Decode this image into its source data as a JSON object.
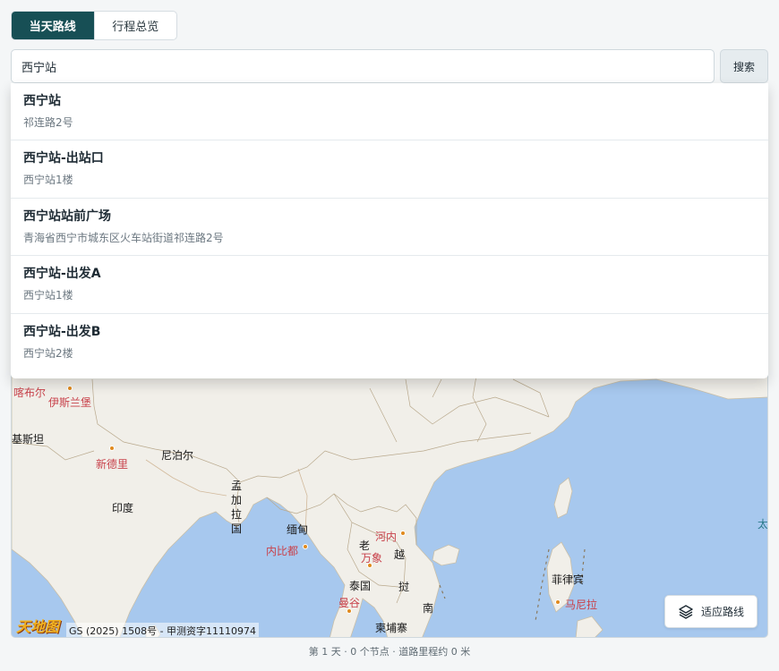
{
  "tabs": [
    {
      "label": "当天路线",
      "active": true
    },
    {
      "label": "行程总览",
      "active": false
    }
  ],
  "search": {
    "value": "西宁站",
    "button_label": "搜索"
  },
  "suggestions": [
    {
      "title": "西宁站",
      "subtitle": "祁连路2号"
    },
    {
      "title": "西宁站-出站口",
      "subtitle": "西宁站1楼"
    },
    {
      "title": "西宁站站前广场",
      "subtitle": "青海省西宁市城东区火车站街道祁连路2号"
    },
    {
      "title": "西宁站-出发A",
      "subtitle": "西宁站1楼"
    },
    {
      "title": "西宁站-出发B",
      "subtitle": "西宁站2楼"
    }
  ],
  "map": {
    "labels": {
      "kabul": "喀布尔",
      "islamabad": "伊斯兰堡",
      "pakistan": "巴基斯坦",
      "new_delhi": "新德里",
      "nepal": "尼泊尔",
      "india": "印度",
      "bangladesh": "孟加拉国",
      "myanmar": "缅甸",
      "naypyidaw": "内比都",
      "laos": "老",
      "hanoi": "河内",
      "vientiane": "万象",
      "vietnam_a": "越",
      "thailand": "泰国",
      "bangkok": "曼谷",
      "vietnam_b": "挝",
      "vietnam_c": "南",
      "cambodia": "柬埔寨",
      "philippines": "菲律宾",
      "manila": "马尼拉",
      "taiwan_edge": "太"
    },
    "provider_logo": "天地图",
    "copyright": "GS (2025) 1508号 - 甲测资字11110974",
    "fit_button_label": "适应路线",
    "layers_icon": "layers-icon"
  },
  "footer": {
    "status": "第 1 天 · 0 个节点 · 道路里程约 0 米"
  },
  "colors": {
    "accent": "#174f55",
    "sea": "#a7c8ee",
    "land": "#f1efe9",
    "city": "#c8424b"
  }
}
